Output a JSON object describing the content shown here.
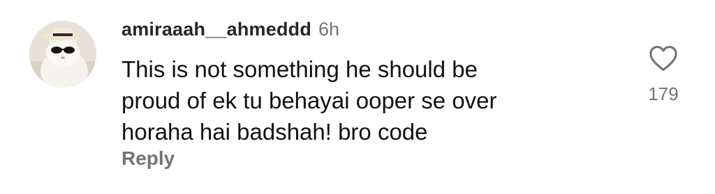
{
  "comment": {
    "username": "amiraaah__ahmeddd",
    "timestamp": "6h",
    "text": "This is not something he should be\nproud of ek tu behayai ooper se over\nhoraha hai badshah! bro code",
    "reply_label": "Reply",
    "like_count": "179",
    "icons": {
      "like": "heart-outline-icon",
      "avatar": "avatar-cat-with-hat-and-sunglasses"
    },
    "colors": {
      "username": "#262626",
      "secondary_text": "#737373",
      "body_text": "#111111",
      "background": "#ffffff"
    }
  }
}
